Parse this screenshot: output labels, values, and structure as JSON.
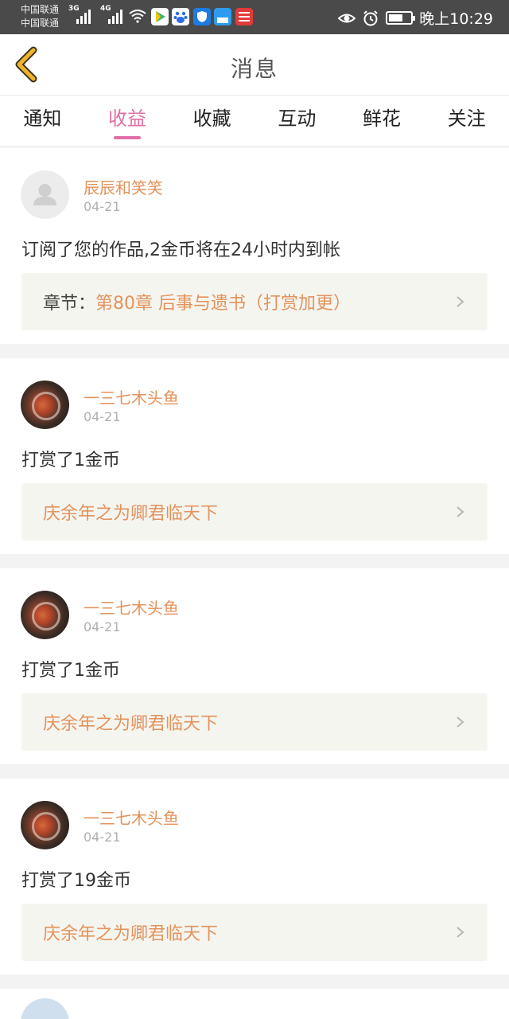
{
  "status_bar": {
    "carrier_1": "中国联通",
    "carrier_2": "中国联通",
    "net_1": "3G",
    "net_2": "4G",
    "time": "晚上10:29",
    "icons": [
      "signal-icon",
      "wifi-icon",
      "video-app-icon",
      "baidu-app-icon",
      "security-app-icon",
      "message-app-icon",
      "toutiao-app-icon",
      "eye-icon",
      "alarm-icon",
      "battery-icon"
    ]
  },
  "header": {
    "title": "消息",
    "back_icon": "chevron-left-icon"
  },
  "tabs": [
    {
      "label": "通知",
      "active": false
    },
    {
      "label": "收益",
      "active": true
    },
    {
      "label": "收藏",
      "active": false
    },
    {
      "label": "互动",
      "active": false
    },
    {
      "label": "鲜花",
      "active": false
    },
    {
      "label": "关注",
      "active": false
    }
  ],
  "feed": [
    {
      "user": "辰辰和笑笑",
      "date": "04-21",
      "message": "订阅了您的作品,2金币将在24小时内到帐",
      "link_label": "章节：",
      "link_title": "第80章 后事与遗书（打赏加更）"
    },
    {
      "user": "一三七木头鱼",
      "date": "04-21",
      "message": "打赏了1金币",
      "link_label": "",
      "link_title": "庆余年之为卿君临天下"
    },
    {
      "user": "一三七木头鱼",
      "date": "04-21",
      "message": "打赏了1金币",
      "link_label": "",
      "link_title": "庆余年之为卿君临天下"
    },
    {
      "user": "一三七木头鱼",
      "date": "04-21",
      "message": "打赏了19金币",
      "link_label": "",
      "link_title": "庆余年之为卿君临天下"
    }
  ],
  "colors": {
    "accent_pink": "#e06fa6",
    "accent_orange": "#e3935c",
    "back_icon_yellow": "#f0b429",
    "status_bar": "#4a4a4a"
  }
}
